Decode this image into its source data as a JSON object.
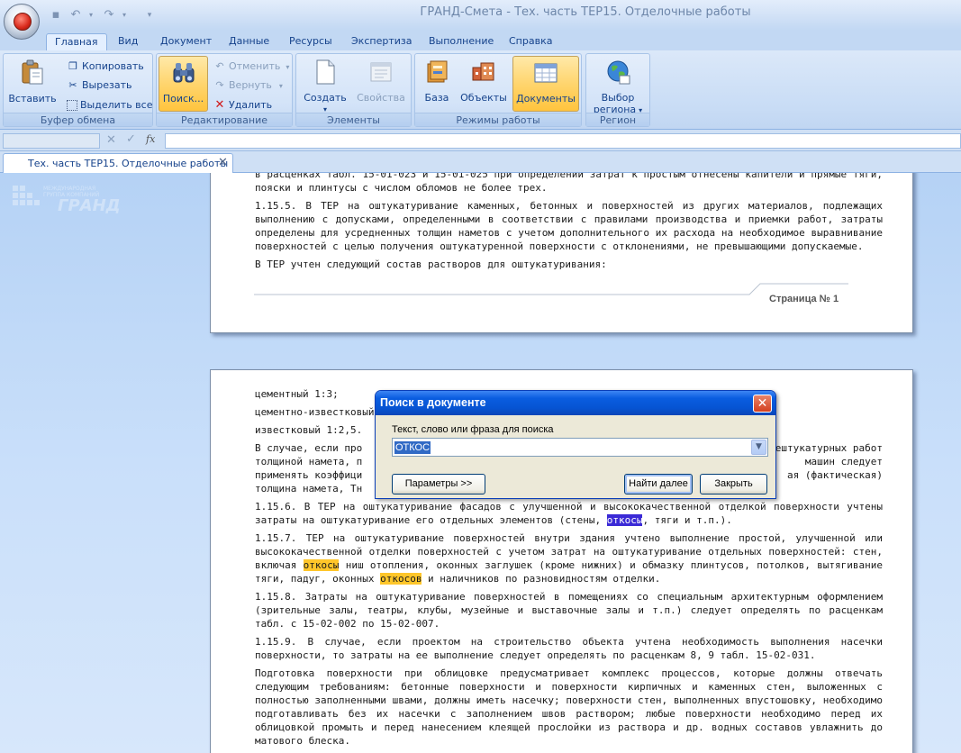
{
  "app": {
    "title": "ГРАНД-Смета - Тех. часть ТЕР15. Отделочные работы"
  },
  "menu_tabs": [
    "Главная",
    "Вид",
    "Документ",
    "Данные",
    "Ресурсы",
    "Экспертиза",
    "Выполнение",
    "Справка"
  ],
  "ribbon": {
    "clipboard": {
      "caption": "Буфер обмена",
      "paste": "Вставить",
      "copy": "Копировать",
      "cut": "Вырезать",
      "select_all": "Выделить все"
    },
    "editing": {
      "caption": "Редактирование",
      "search": "Поиск...",
      "undo": "Отменить",
      "redo": "Вернуть",
      "delete": "Удалить"
    },
    "elements": {
      "caption": "Элементы",
      "create": "Создать",
      "properties": "Свойства"
    },
    "modes": {
      "caption": "Режимы работы",
      "base": "База",
      "objects": "Объекты",
      "documents": "Документы"
    },
    "region": {
      "caption": "Регион",
      "select_line1": "Выбор",
      "select_line2": "региона"
    }
  },
  "formula_bar": {
    "fx": "fx"
  },
  "doc_tab": {
    "label": "Тех. часть ТЕР15. Отделочные работы"
  },
  "watermark": {
    "line1": "МЕЖДУНАРОДНАЯ",
    "line2": "ГРУППА КОМПАНИЙ",
    "line3": "ГРАНД"
  },
  "page1": {
    "p0": "в расценках табл. 15-01-023 и 15-01-025 при определении затрат к простым отнесены капители и прямые тяги, пояски и плинтусы с числом обломов не более трех.",
    "p1": "1.15.5. В ТЕР на оштукатуривание каменных, бетонных и поверхностей из других материалов, подлежащих выполнению с допусками, определенными в соответствии с правилами производства и приемки работ, затраты определены для усредненных толщин наметов с учетом дополнительного их расхода на необходимое выравнивание поверхностей с целью получения оштукатуренной поверхности с отклонениями, не превышающими допускаемые.",
    "p2": "В ТЕР учтен следующий состав растворов для оштукатуривания:",
    "footer": "Страница № 1"
  },
  "page2": {
    "l1": "цементный 1:3;",
    "l2": "цементно-известковый",
    "l3": "известковый 1:2,5.",
    "p4a": "В случае, если про",
    "p4b": "ештукатурных работ",
    "p4c": "толщиной намета, п",
    "p4d": "машин следует",
    "p4e": "применять коэффици",
    "p4f": "ая (фактическая)",
    "p4g": "толщина намета, Тн",
    "p5a": "1.15.6. В ТЕР на оштукатуривание фасадов с улучшенной и высококачественной отделкой поверхности учтены затраты на оштукатуривание его отдельных элементов (стены, ",
    "p5hl": "откосы",
    "p5b": ", тяги и т.п.).",
    "p6a": "1.15.7. ТЕР на оштукатуривание поверхностей внутри здания учтено выполнение простой, улучшенной или высококачественной отделки поверхностей с учетом затрат на оштукатуривание отдельных поверхностей: стен, включая ",
    "p6hl1": "откосы",
    "p6b": " ниш отопления, оконных заглушек (кроме нижних) и обмазку плинтусов, потолков, вытягивание тяги, падуг, оконных ",
    "p6hl2": "откосов",
    "p6c": " и наличников по разновидностям отделки.",
    "p7": "1.15.8. Затраты на оштукатуривание поверхностей в помещениях со специальным архитектурным оформлением (зрительные залы, театры, клубы, музейные и выставочные залы и т.п.) следует определять по расценкам табл. с 15-02-002 по 15-02-007.",
    "p8": "1.15.9. В случае, если проектом на строительство объекта учтена необходимость выполнения насечки поверхности, то затраты на ее выполнение следует определять по расценкам 8, 9 табл. 15-02-031.",
    "p9": "Подготовка поверхности при облицовке предусматривает комплекс процессов, которые должны отвечать следующим требованиям: бетонные поверхности и поверхности кирпичных и каменных стен, выложенных с полностью заполненными швами, должны иметь насечку; поверхности стен, выполненных впустошовку, необходимо подготавливать без их насечки с заполнением швов раствором; любые поверхности необходимо перед их облицовкой промыть и перед нанесением клеящей прослойки из раствора и др. водных составов увлажнить до матового блеска."
  },
  "dialog": {
    "title": "Поиск в документе",
    "label": "Текст, слово или фраза для поиска",
    "value": "ОТКОС",
    "params_button": "Параметры >>",
    "find_next_button": "Найти далее",
    "close_button": "Закрыть"
  }
}
